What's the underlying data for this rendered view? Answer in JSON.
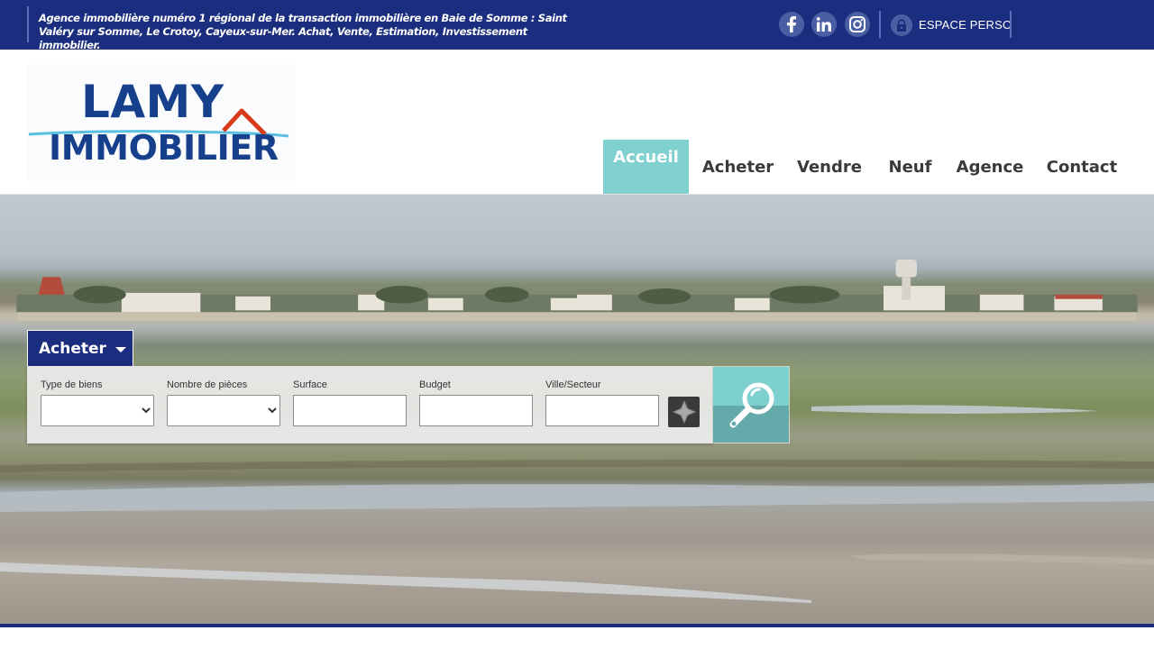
{
  "topbar": {
    "tagline": "Agence immobilière numéro 1 régional de la transaction immobilière en Baie de Somme : Saint Valéry sur Somme, Le Crotoy, Cayeux-sur-Mer. Achat, Vente, Estimation, Investissement immobilier.",
    "social": [
      "facebook-icon",
      "linkedin-icon",
      "instagram-icon"
    ],
    "espace_label": "ESPACE PERSO",
    "background_color": "#1b2d7e"
  },
  "logo": {
    "line1": "LAMY",
    "line2": "IMMOBILIER",
    "brand_color": "#163f8c",
    "roof_color": "#d83a1c"
  },
  "nav": {
    "items": [
      {
        "label": "Accueil",
        "active": true
      },
      {
        "label": "Acheter",
        "active": false
      },
      {
        "label": "Vendre",
        "active": false
      },
      {
        "label": "Neuf",
        "active": false
      },
      {
        "label": "Agence",
        "active": false
      },
      {
        "label": "Contact",
        "active": false
      }
    ],
    "active_color": "#7fd0cf"
  },
  "search": {
    "tab_label": "Acheter",
    "fields": {
      "type": {
        "label": "Type de biens",
        "value": ""
      },
      "pieces": {
        "label": "Nombre de pièces",
        "value": ""
      },
      "surface": {
        "label": "Surface",
        "value": ""
      },
      "budget": {
        "label": "Budget",
        "value": ""
      },
      "ville": {
        "label": "Ville/Secteur",
        "value": ""
      }
    },
    "geo_icon": "locate-icon",
    "submit_icon": "magnifier-icon",
    "submit_color": "#7ed0cf"
  }
}
